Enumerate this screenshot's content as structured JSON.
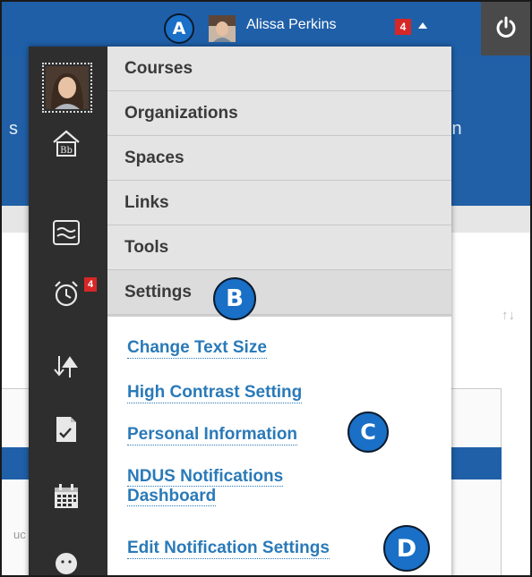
{
  "background": {
    "left_fragment": "s",
    "right_fragment": "in",
    "left_lower_fragment": "uc",
    "sort_glyph": "↑↓"
  },
  "user": {
    "name": "Alissa Perkins",
    "notification_count": "4"
  },
  "callouts": {
    "a": "A",
    "b": "B",
    "c": "C",
    "d": "D"
  },
  "rail": {
    "icons": [
      "bb-home-icon",
      "activity-stream-icon",
      "calendar-alarm-icon",
      "upload-arrows-icon",
      "grades-icon",
      "calendar-icon",
      "face-icon"
    ],
    "alarm_badge": "4"
  },
  "menu": {
    "items": [
      "Courses",
      "Organizations",
      "Spaces",
      "Links",
      "Tools",
      "Settings"
    ],
    "active": "Settings"
  },
  "settings_links": [
    "Change Text Size",
    "High Contrast Setting",
    "Personal Information",
    "NDUS Notifications Dashboard",
    "Edit Notification Settings"
  ],
  "colors": {
    "topbar": "#1f5fa8",
    "callout_blue": "#1a6fc6",
    "badge_red": "#d62727",
    "link_blue": "#2a7ab8",
    "rail_dark": "#2e2e2e"
  }
}
